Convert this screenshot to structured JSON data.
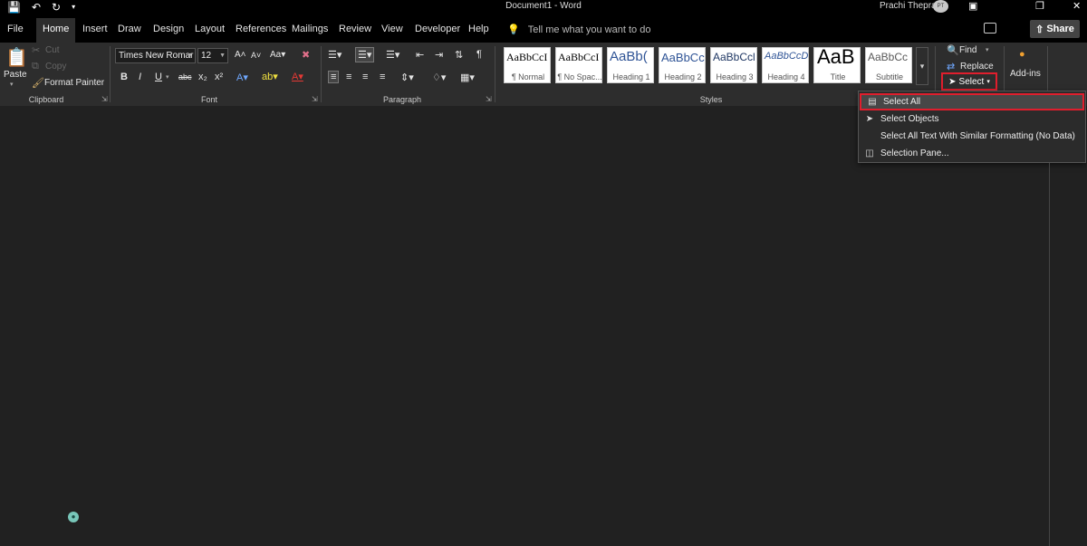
{
  "titlebar": {
    "doc_title": "Document1  -  Word",
    "user_name": "Prachi Thepra",
    "avatar_initials": "PT",
    "qat_icons": [
      "save-icon",
      "undo-icon",
      "redo-icon",
      "customize-qat-icon"
    ]
  },
  "tabs": [
    "File",
    "Home",
    "Insert",
    "Draw",
    "Design",
    "Layout",
    "References",
    "Mailings",
    "Review",
    "View",
    "Developer",
    "Help"
  ],
  "active_tab": "Home",
  "tell_me": "Tell me what you want to do",
  "share_label": "Share",
  "clipboard": {
    "paste": "Paste",
    "cut": "Cut",
    "copy": "Copy",
    "format_painter": "Format Painter",
    "label": "Clipboard"
  },
  "font": {
    "name": "Times New Romar",
    "size": "12",
    "label": "Font"
  },
  "paragraph": {
    "label": "Paragraph"
  },
  "styles": {
    "label": "Styles",
    "tiles": [
      {
        "sample": "AaBbCcI",
        "name": "¶ Normal"
      },
      {
        "sample": "AaBbCcI",
        "name": "¶ No Spac..."
      },
      {
        "sample": "AaBb(",
        "name": "Heading 1"
      },
      {
        "sample": "AaBbCc",
        "name": "Heading 2"
      },
      {
        "sample": "AaBbCcl",
        "name": "Heading 3"
      },
      {
        "sample": "AaBbCcD.",
        "name": "Heading 4"
      },
      {
        "sample": "AaB",
        "name": "Title"
      },
      {
        "sample": "AaBbCc",
        "name": "Subtitle"
      }
    ]
  },
  "editing": {
    "find": "Find",
    "replace": "Replace",
    "select": "Select"
  },
  "addins_label": "Add-ins",
  "select_menu": [
    {
      "label": "Select All",
      "icon": "select-all-icon"
    },
    {
      "label": "Select Objects",
      "icon": "pointer-icon"
    },
    {
      "label": "Select All Text With Similar Formatting (No Data)",
      "icon": ""
    },
    {
      "label": "Selection Pane...",
      "icon": "selection-pane-icon"
    }
  ],
  "colors": {
    "highlight_border": "#e01e2d",
    "background": "#212121",
    "ribbon": "#2d2d2d"
  }
}
